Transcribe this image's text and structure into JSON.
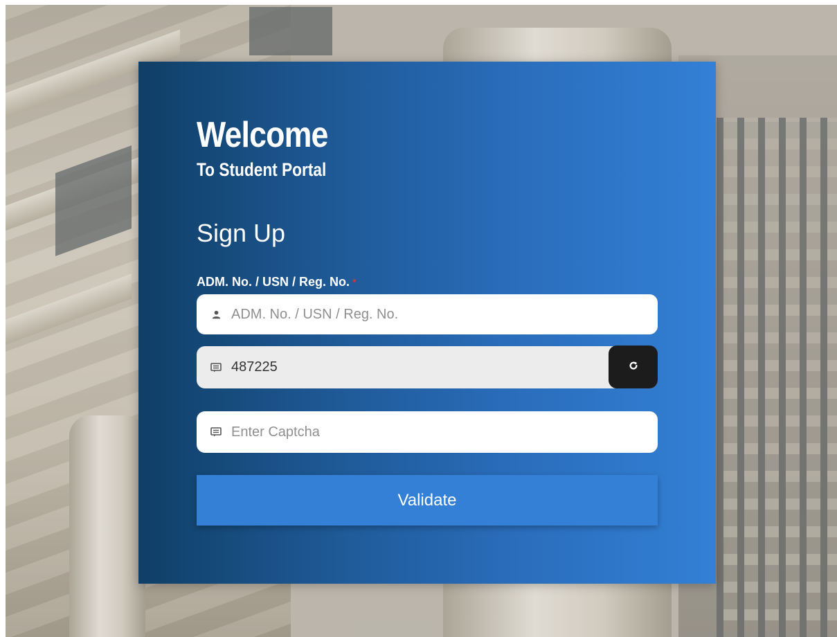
{
  "header": {
    "welcome": "Welcome",
    "subtitle": "To Student Portal"
  },
  "form": {
    "title": "Sign Up",
    "adm_label": "ADM. No. / USN / Reg. No.",
    "required_mark": "*",
    "adm_placeholder": "ADM. No. / USN / Reg. No.",
    "captcha_value": "487225",
    "captcha_placeholder": "Enter Captcha",
    "validate_label": "Validate",
    "icons": {
      "adm": "user-icon",
      "captcha_display": "message-icon",
      "captcha_entry": "message-icon",
      "refresh": "refresh-icon"
    }
  },
  "colors": {
    "card_gradient_start": "#0f3f66",
    "card_gradient_end": "#3380d6",
    "button": "#3380d6",
    "refresh_button": "#1c1c1c",
    "required": "#e0303a"
  }
}
